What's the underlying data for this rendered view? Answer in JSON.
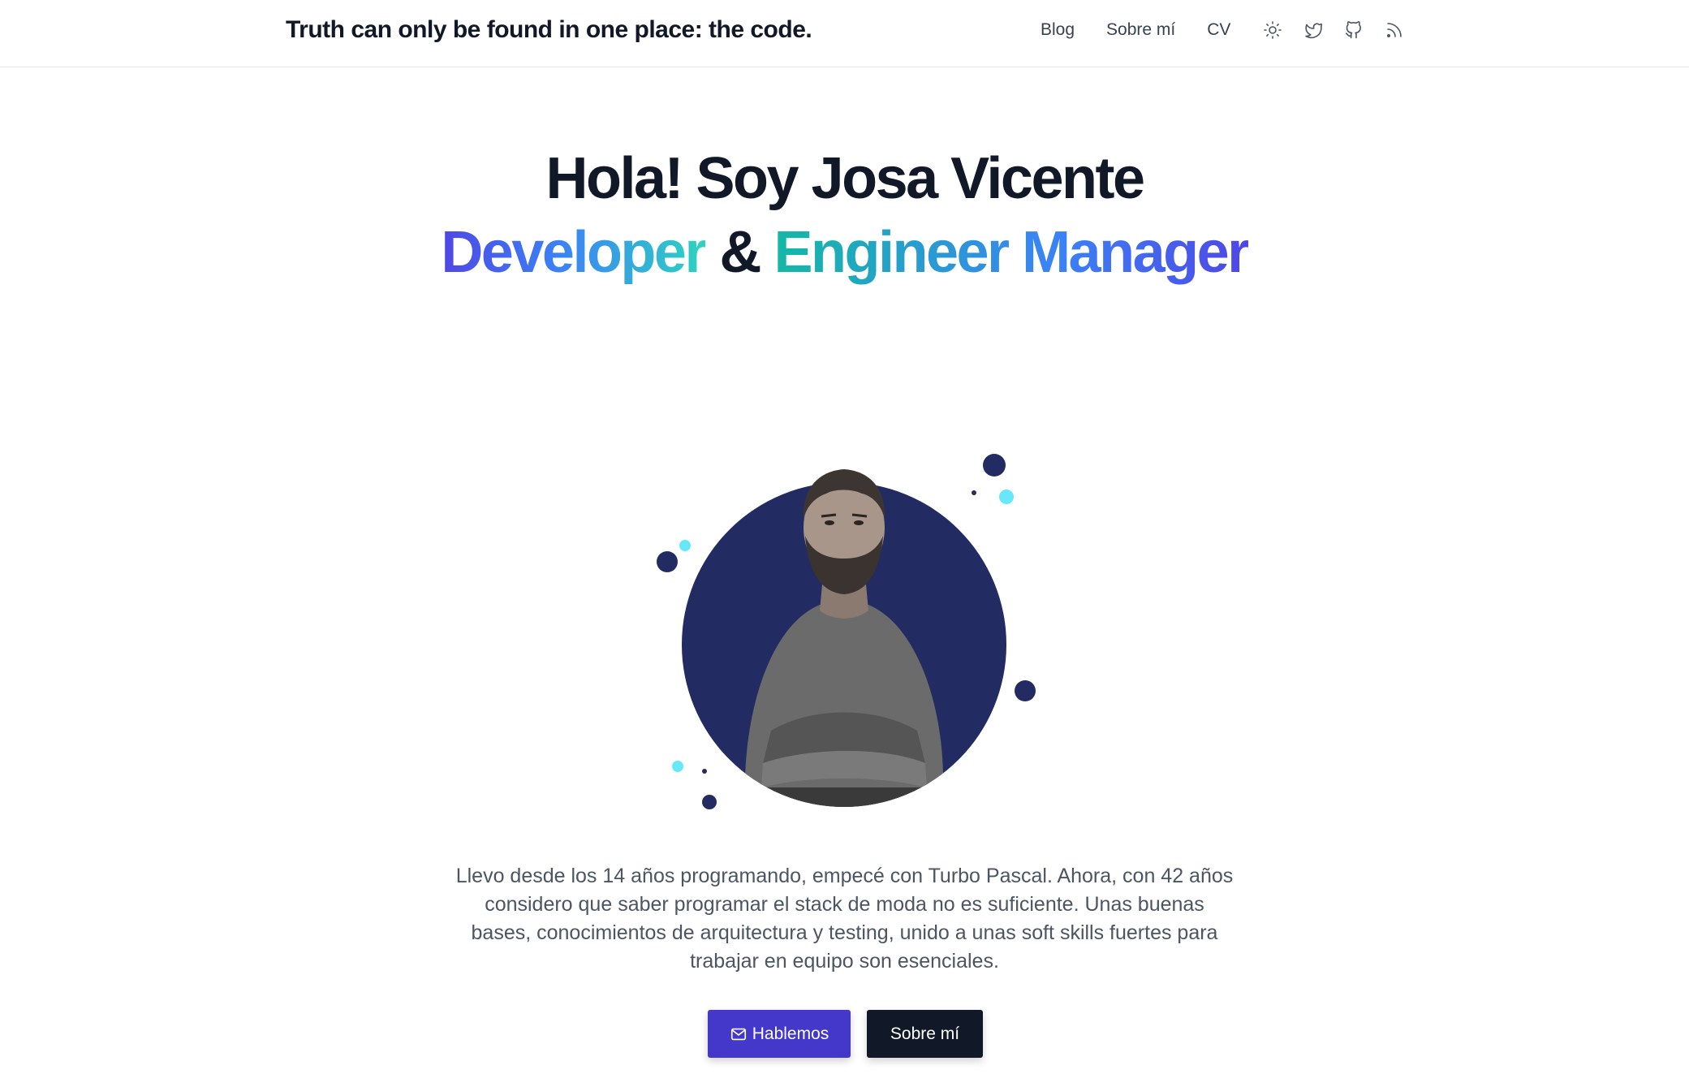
{
  "header": {
    "brand": "Truth can only be found in one place: the code.",
    "nav": [
      "Blog",
      "Sobre mí",
      "CV"
    ],
    "icons": [
      "sun-icon",
      "twitter-icon",
      "github-icon",
      "rss-icon"
    ]
  },
  "hero": {
    "title": "Hola! Soy Josa Vicente",
    "role1": "Developer",
    "amp": "&",
    "role2": "Engineer Manager"
  },
  "bio": "Llevo desde los 14 años programando, empecé con Turbo Pascal. Ahora, con 42 años considero que saber programar el stack de moda no es suficiente. Unas buenas bases, conocimientos de arquitectura y testing, unido a unas soft skills fuertes para trabajar en equipo son esenciales.",
  "buttons": {
    "primary": "Hablemos",
    "secondary": "Sobre mí"
  },
  "colors": {
    "accent": "#4338ca",
    "dark": "#111827",
    "circle": "#222c63",
    "cyan": "#67e8f9"
  }
}
